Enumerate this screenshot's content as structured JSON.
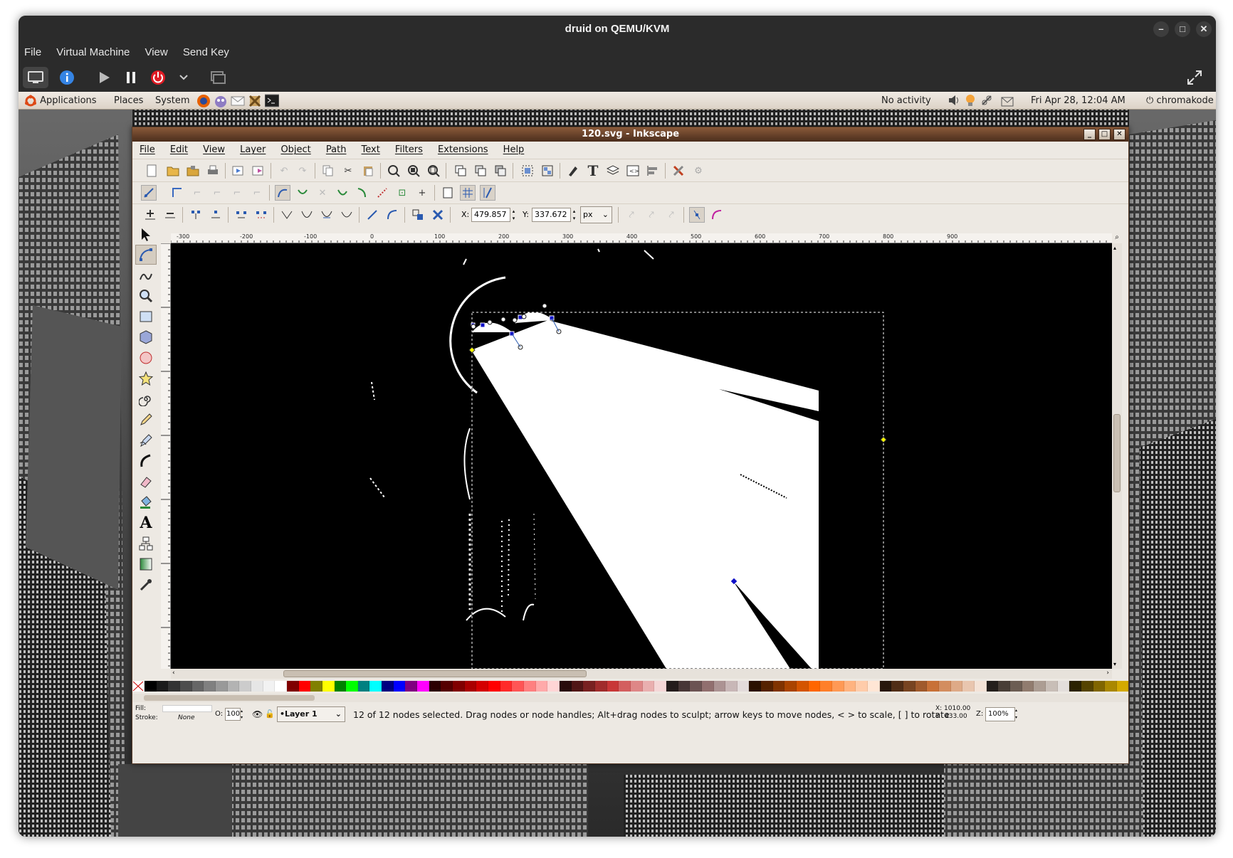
{
  "vm": {
    "title": "druid on QEMU/KVM",
    "menu": [
      "File",
      "Virtual Machine",
      "View",
      "Send Key"
    ],
    "window_controls": [
      "minimize-icon",
      "maximize-icon",
      "close-icon"
    ]
  },
  "gnome_panel": {
    "menus": [
      "Applications",
      "Places",
      "System"
    ],
    "activity": "No activity",
    "datetime": "Fri Apr 28, 12:04 AM",
    "user": "chromakode"
  },
  "inkscape": {
    "title": "120.svg - Inkscape",
    "menu": [
      "File",
      "Edit",
      "View",
      "Layer",
      "Object",
      "Path",
      "Text",
      "Filters",
      "Extensions",
      "Help"
    ],
    "x_label": "X:",
    "x_value": "479.857",
    "y_label": "Y:",
    "y_value": "337.672",
    "unit": "px",
    "ruler_labels": [
      "-300",
      "-200",
      "-100",
      "0",
      "100",
      "200",
      "300",
      "400",
      "500",
      "600",
      "700",
      "800",
      "900"
    ],
    "fill_label": "Fill:",
    "stroke_label": "Stroke:",
    "stroke_value": "None",
    "opacity_label": "O:",
    "opacity_value": "100",
    "layer": "•Layer 1",
    "status_text": "12 of 12 nodes selected. Drag nodes or node handles; Alt+drag nodes to sculpt; arrow keys to move nodes, < > to scale, [ ] to rotate",
    "cursor_x": "X: 1010.00",
    "cursor_y": "Y:  433.00",
    "zoom_label": "Z:",
    "zoom": "100%"
  },
  "colors": {
    "vm_chrome": "#2b2b2b",
    "panel": "#e6dfd5",
    "inkscape_titlebar": "#6b4429",
    "inkscape_bg": "#ede9e3",
    "canvas": "#000000",
    "selection_handle": "#ffff00",
    "node": "#1010c8"
  },
  "palette": [
    "#000000",
    "#1a1a1a",
    "#333333",
    "#4d4d4d",
    "#666666",
    "#808080",
    "#999999",
    "#b3b3b3",
    "#cccccc",
    "#e6e6e6",
    "#f2f2f2",
    "#ffffff",
    "#800000",
    "#ff0000",
    "#808000",
    "#ffff00",
    "#008000",
    "#00ff00",
    "#008080",
    "#00ffff",
    "#000080",
    "#0000ff",
    "#800080",
    "#ff00ff",
    "#2b0000",
    "#550000",
    "#800000",
    "#aa0000",
    "#d40000",
    "#ff0000",
    "#ff2a2a",
    "#ff5555",
    "#ff8080",
    "#ffaaaa",
    "#ffd5d5",
    "#280b0b",
    "#501616",
    "#782121",
    "#a02c2c",
    "#c83737",
    "#d35f5f",
    "#de8787",
    "#e9afaf",
    "#f4d7d7",
    "#241c1c",
    "#483737",
    "#6c5353",
    "#916f6f",
    "#ac9393",
    "#c8b7b7",
    "#e3dbdb",
    "#2b1100",
    "#552200",
    "#803300",
    "#aa4400",
    "#d45500",
    "#ff6600",
    "#ff7f2a",
    "#ff9955",
    "#ffb380",
    "#ffccaa",
    "#ffe6d5",
    "#28170b",
    "#502d16",
    "#784421",
    "#a05a2c",
    "#c87137",
    "#d38d5f",
    "#deaa87",
    "#e9c6af",
    "#f4e3d7",
    "#241f1c",
    "#483e37",
    "#6c5d53",
    "#917c6f",
    "#ac9d93",
    "#c8beb7",
    "#e3dedb",
    "#2b2200",
    "#554400",
    "#806600",
    "#aa8800",
    "#d4aa00"
  ]
}
